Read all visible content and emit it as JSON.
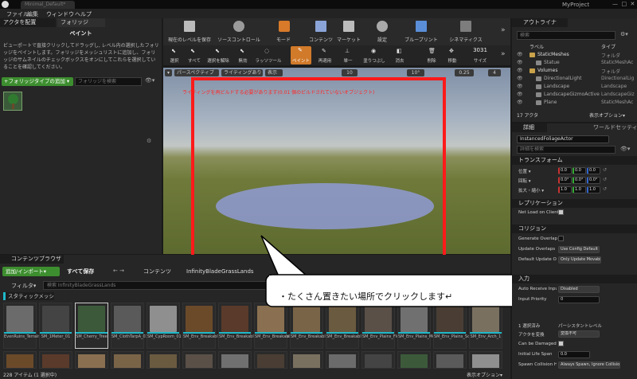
{
  "window": {
    "tab_title": "Minimal_Default*",
    "project": "MyProject"
  },
  "menu": [
    "ファイル",
    "編集",
    "ウィンドウ",
    "ヘルプ"
  ],
  "left_panel": {
    "tabs": [
      "アクタを配置",
      "フォリッジ"
    ],
    "mode_title": "ペイント",
    "instructions": "ビューポートで直接クリックしてドラッグし, レベル内の選択したフォリッジをペイントします。フォリッジをメッシュリストに追加し、フォリッジのサムネイルのチェックボックスをオンにしてこれらを選択していることを確認してください。",
    "add_button": "+フォリッジタイプの追加 ▾",
    "search_placeholder": "フォリッジを検索"
  },
  "main_toolbar": {
    "items": [
      "現在のレベルを保存",
      "ソースコントロール",
      "モード",
      "コンテンツ",
      "マーケット",
      "設定",
      "ブループリント",
      "シネマティクス"
    ]
  },
  "foliage_tools": {
    "items": [
      "選択",
      "すべて",
      "選択を解除",
      "無効",
      "ラッソツール",
      "ペイント",
      "再適用",
      "単一",
      "塗りつぶし",
      "消去",
      "削除",
      "移動",
      "サイズ"
    ],
    "size_value": "3031"
  },
  "viewport": {
    "perspective_label": "パースペクティブ",
    "lit_label": "ライティングあり",
    "show_label": "表示",
    "warning": "ライティングを再ビルドする必要があります(0.01 個のビルドされていないオブジェクト)",
    "grid_value": "10",
    "angle_value": "10°",
    "scale_value": "0.25",
    "camera_speed": "4",
    "highlight_color": "#ff1a1a"
  },
  "callout": {
    "text": "・たくさん置きたい場所でクリックします↵"
  },
  "outliner": {
    "title": "アウトライナ",
    "search_placeholder": "検索",
    "col_label": "ラベル",
    "col_type": "タイプ",
    "rows": [
      {
        "name": "StaticMeshes",
        "type": "フォルダ"
      },
      {
        "name": "Statue",
        "type": "StaticMeshAc"
      },
      {
        "name": "Volumes",
        "type": "フォルダ"
      },
      {
        "name": "DirectionalLight",
        "type": "DirectionalLig"
      },
      {
        "name": "Landscape",
        "type": "Landscape"
      },
      {
        "name": "LandscapeGizmoActiveLandscapeGi",
        "type": "LandscapeGiz"
      },
      {
        "name": "Plane",
        "type": "StaticMeshAc"
      }
    ],
    "actor_count": "17 アクタ",
    "view_options": "表示オプション▾"
  },
  "details": {
    "tabs": [
      "詳細",
      "ワールドセッティン"
    ],
    "actor_name": "InstancedFoliageActor",
    "search_placeholder": "詳細を検索",
    "transform": {
      "title": "トランスフォーム",
      "rows": [
        {
          "label": "位置 ▾",
          "values": [
            "0.0",
            "0.0",
            "0.0"
          ]
        },
        {
          "label": "回転 ▾",
          "values": [
            "0.0°",
            "0.0°",
            "0.0°"
          ]
        },
        {
          "label": "拡大・縮小 ▾",
          "values": [
            "1.0",
            "1.0",
            "1.0"
          ]
        }
      ]
    },
    "replication": {
      "title": "レプリケーション",
      "rows": [
        "Net Load on Client"
      ]
    },
    "collision": {
      "title": "コリジョン",
      "rows": [
        {
          "label": "Generate Overlap",
          "value": ""
        },
        {
          "label": "Update Overlaps M",
          "value": "Use Config Default ▾"
        },
        {
          "label": "Default Update Ov",
          "value": "Only Update Movable ▾"
        }
      ]
    },
    "input": {
      "title": "入力",
      "rows": [
        {
          "label": "Auto Receive Input",
          "value": "Disabled"
        },
        {
          "label": "Input Priority",
          "value": "0"
        }
      ]
    },
    "actor": {
      "selected_label": "1 選択済み",
      "persistent_level": "パーシスタントレベル",
      "rows": [
        {
          "label": "アクタを変換",
          "value": "変換不可"
        },
        {
          "label": "Can be Damaged",
          "value": ""
        },
        {
          "label": "Initial Life Span",
          "value": "0.0"
        },
        {
          "label": "Spawn Collision H",
          "value": "Always Spawn, Ignore Collisio ▾"
        }
      ]
    }
  },
  "content_browser": {
    "title": "コンテンツブラウザ",
    "add_import": "追加/インポート▾",
    "save_all": "すべて保存",
    "path": [
      "コンテンツ",
      "InfinityBladeGrassLands"
    ],
    "filters": "フィルタ▾",
    "search_placeholder": "検索 InfinityBladeGrassLands",
    "filter_chip": "スタティックメッシュ",
    "items": [
      "EvenRuins_Terrain",
      "SM_1Meter_01",
      "SM_Cherry_Tree",
      "SM_ClothTarpA_01",
      "SM_CypRoom_01",
      "SM_Env_Breakables_Box1",
      "SM_Env_Breakables_Box1_destroyed",
      "SM_Env_Breakables_Bowls",
      "SM_Env_Breakables_BowlsBITS",
      "SM_Env_Breakables_Gourds_g",
      "SM_Env_Plains_Floors_Rubble05",
      "SM_Env_Plains_Mountain_01",
      "SM_Env_Plains_Scrap_Bridge_2",
      "SM_Env_Arch_1"
    ],
    "status": "228 アイテム (1 選択中)",
    "view_options": "表示オプション▾"
  }
}
